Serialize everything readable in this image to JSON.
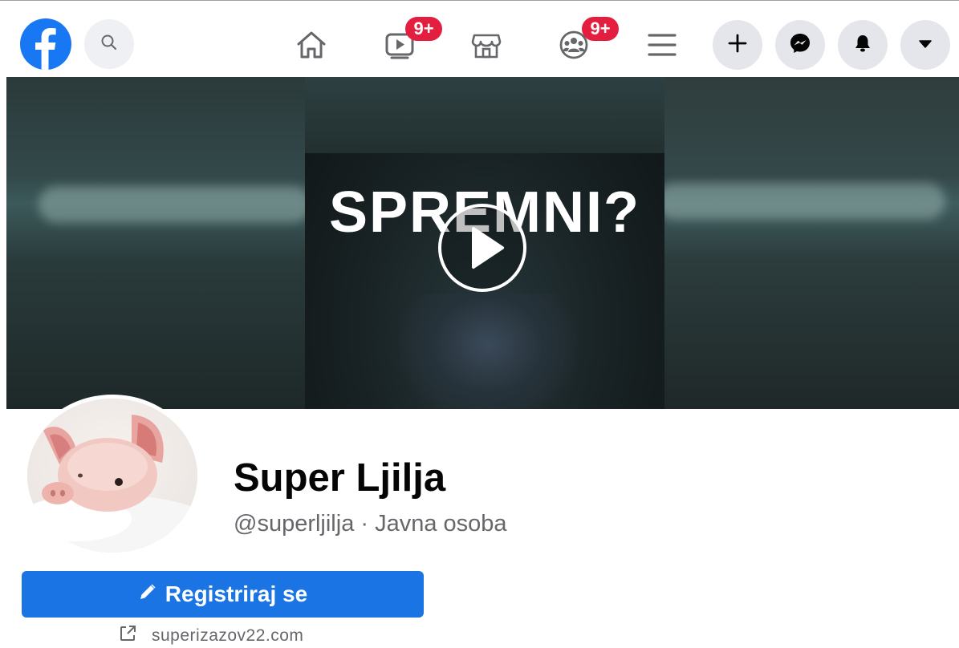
{
  "nav": {
    "icons": {
      "logo": "facebook-logo-icon",
      "search": "search-icon",
      "home": "home-icon",
      "watch": "watch-video-icon",
      "marketplace": "marketplace-icon",
      "groups": "groups-icon",
      "menu": "menu-icon",
      "create": "plus-icon",
      "messenger": "messenger-icon",
      "notifications": "bell-icon",
      "account": "caret-down-icon"
    },
    "watch_badge": "9+",
    "groups_badge": "9+"
  },
  "cover": {
    "title": "SPREMNI?",
    "play_icon": "play-icon"
  },
  "profile": {
    "name": "Super Ljilja",
    "subtitle": "@superljilja · Javna osoba",
    "register_label": "Registriraj se",
    "register_icon": "pencil-icon",
    "website": "superizazov22.com",
    "website_icon": "external-link-icon"
  },
  "colors": {
    "brand": "#1877f2",
    "button": "#1b74e4",
    "badge": "#e41e3f",
    "secondary_text": "#65676b",
    "circle_button_bg": "#e4e6eb"
  }
}
